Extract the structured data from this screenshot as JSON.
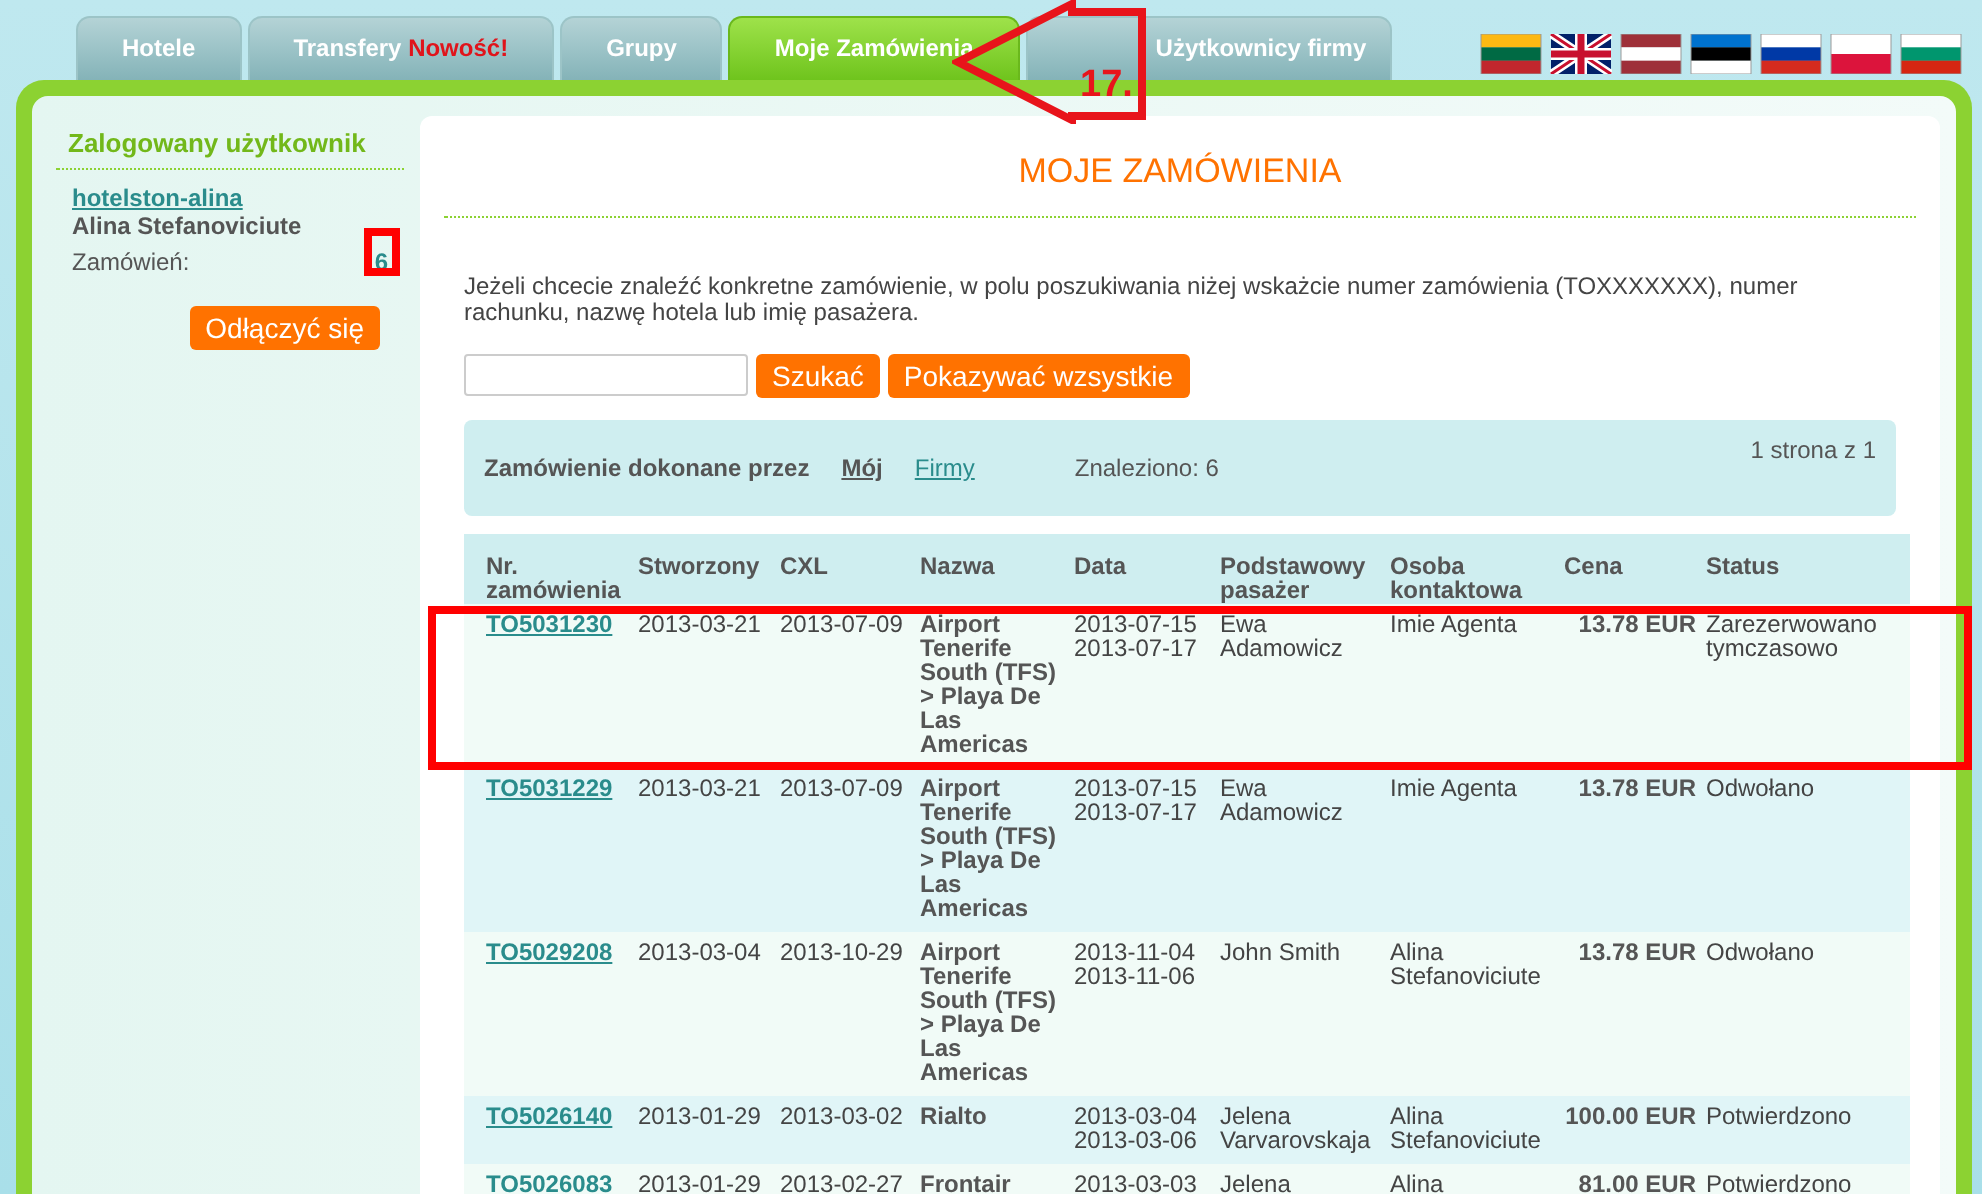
{
  "tabs": [
    {
      "label": "Hotele",
      "selected": false
    },
    {
      "label": "Transfery",
      "badge": "Nowość!",
      "selected": false
    },
    {
      "label": "Grupy",
      "selected": false
    },
    {
      "label": "Moje Zamówienia",
      "selected": true
    },
    {
      "label": "Użytkownicy firmy",
      "selected": false
    }
  ],
  "languages": [
    {
      "kind": "lt"
    },
    {
      "kind": "gb"
    },
    {
      "kind": "lv"
    },
    {
      "kind": "ee"
    },
    {
      "kind": "ru"
    },
    {
      "kind": "pl"
    },
    {
      "kind": "bg"
    }
  ],
  "sidebar": {
    "title": "Zalogowany użytkownik",
    "username": "hotelston-alina",
    "full_name": "Alina Stefanoviciute",
    "orders_label": "Zamówień:",
    "orders_count": "6",
    "logout": "Odłączyć się"
  },
  "main": {
    "title": "MOJE ZAMÓWIENIA",
    "intro": "Jeżeli chcecie znaleźć konkretne zamówienie, w polu poszukiwania niżej wskażcie numer zamówienia (TOXXXXXXX), numer rachunku, nazwę hotela lub imię pasażera.",
    "search_button": "Szukać",
    "show_all_button": "Pokazywać wzsystkie",
    "filter": {
      "label": "Zamówienie dokonane przez",
      "options": [
        {
          "label": "Mój",
          "selected": true
        },
        {
          "label": "Firmy",
          "selected": false
        }
      ],
      "found": "Znaleziono: 6",
      "pages": "1 strona z 1"
    },
    "table": {
      "columns": [
        "Nr. zamówienia",
        "Stworzony",
        "CXL",
        "Nazwa",
        "Data",
        "Podstawowy pasażer",
        "Osoba kontaktowa",
        "Cena",
        "Status"
      ],
      "rows": [
        {
          "order": "TO5031230",
          "created": "2013-03-21",
          "cxl": "2013-07-09",
          "name": "Airport Tenerife South (TFS) > Playa De Las Americas",
          "dates": [
            "2013-07-15",
            "2013-07-17"
          ],
          "passenger": "Ewa Adamowicz",
          "contact": "Imie Agenta",
          "price": "13.78 EUR",
          "status": "Zarezerwowano tymczasowo"
        },
        {
          "order": "TO5031229",
          "created": "2013-03-21",
          "cxl": "2013-07-09",
          "name": "Airport Tenerife South (TFS) > Playa De Las Americas",
          "dates": [
            "2013-07-15",
            "2013-07-17"
          ],
          "passenger": "Ewa Adamowicz",
          "contact": "Imie Agenta",
          "price": "13.78 EUR",
          "status": "Odwołano"
        },
        {
          "order": "TO5029208",
          "created": "2013-03-04",
          "cxl": "2013-10-29",
          "name": "Airport Tenerife South (TFS) > Playa De Las Americas",
          "dates": [
            "2013-11-04",
            "2013-11-06"
          ],
          "passenger": "John Smith",
          "contact": "Alina Stefanoviciute",
          "price": "13.78 EUR",
          "status": "Odwołano"
        },
        {
          "order": "TO5026140",
          "created": "2013-01-29",
          "cxl": "2013-03-02",
          "name": "Rialto",
          "dates": [
            "2013-03-04",
            "2013-03-06"
          ],
          "passenger": "Jelena Varvarovskaja",
          "contact": "Alina Stefanoviciute",
          "price": "100.00 EUR",
          "status": "Potwierdzono"
        },
        {
          "order": "TO5026083",
          "created": "2013-01-29",
          "cxl": "2013-02-27",
          "name": "Frontair",
          "dates": [
            "2013-03-03"
          ],
          "passenger": "Jelena",
          "contact": "Alina",
          "price": "81.00 EUR",
          "status": "Potwierdzono"
        }
      ]
    }
  },
  "annotation": {
    "label": "17."
  }
}
